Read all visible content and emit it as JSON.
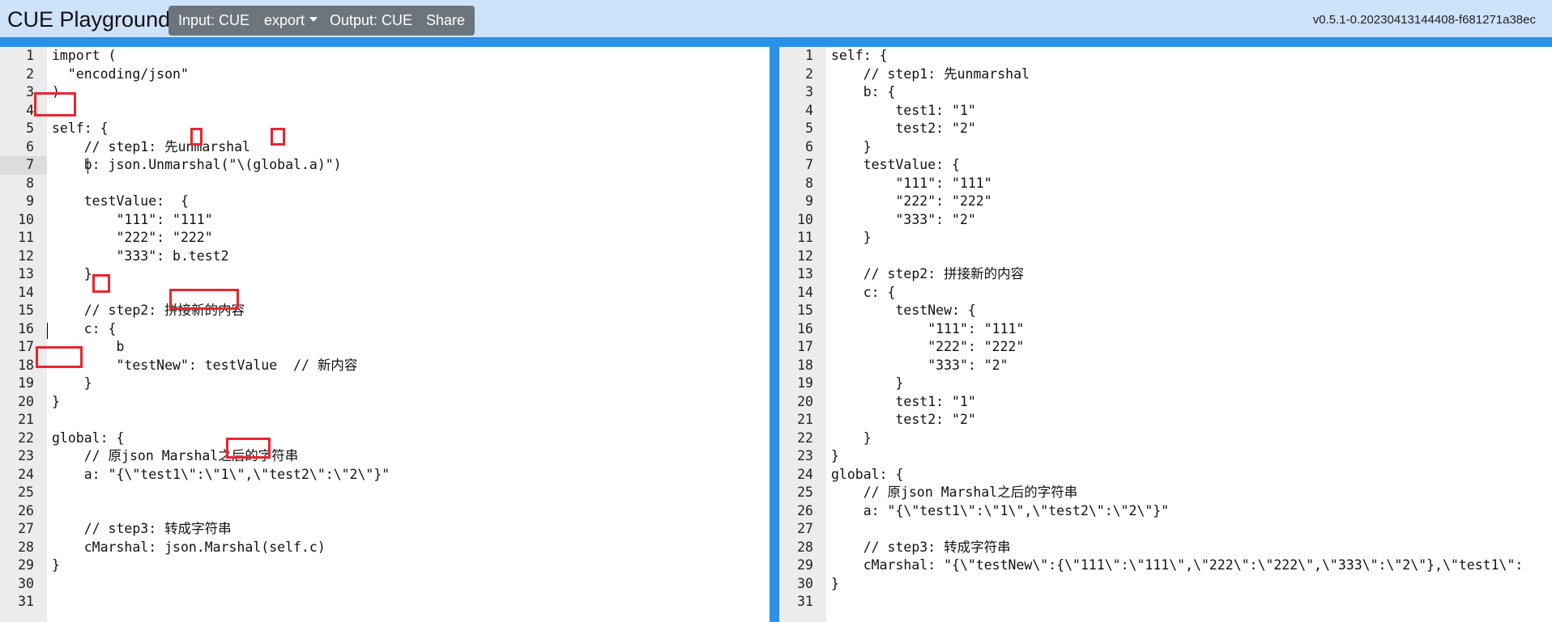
{
  "header": {
    "title": "CUE Playground",
    "buttons": {
      "input": "Input: CUE",
      "export": "export",
      "output": "Output: CUE",
      "share": "Share"
    },
    "version": "v0.5.1-0.20230413144408-f681271a38ec"
  },
  "colors": {
    "header_bg": "#cfe2fb",
    "accent_blue": "#2b90e8",
    "button_bg": "#6c757d",
    "highlight_red": "#e8262f"
  },
  "left_editor": {
    "lines": [
      {
        "n": "1",
        "t": "import ("
      },
      {
        "n": "2",
        "t": "  \"encoding/json\""
      },
      {
        "n": "3",
        "t": ")"
      },
      {
        "n": "4",
        "t": ""
      },
      {
        "n": "5",
        "t": "self: {"
      },
      {
        "n": "6",
        "t": "    // step1: 先unmarshal"
      },
      {
        "n": "7",
        "t": "    b: json.Unmarshal(\"\\(global.a)\")"
      },
      {
        "n": "8",
        "t": ""
      },
      {
        "n": "9",
        "t": "    testValue:  {"
      },
      {
        "n": "10",
        "t": "        \"111\": \"111\""
      },
      {
        "n": "11",
        "t": "        \"222\": \"222\""
      },
      {
        "n": "12",
        "t": "        \"333\": b.test2"
      },
      {
        "n": "13",
        "t": "    }"
      },
      {
        "n": "14",
        "t": ""
      },
      {
        "n": "15",
        "t": "    // step2: 拼接新的内容"
      },
      {
        "n": "16",
        "t": "    c: {"
      },
      {
        "n": "17",
        "t": "        b"
      },
      {
        "n": "18",
        "t": "        \"testNew\": testValue  // 新内容"
      },
      {
        "n": "19",
        "t": "    }"
      },
      {
        "n": "20",
        "t": "}"
      },
      {
        "n": "21",
        "t": ""
      },
      {
        "n": "22",
        "t": "global: {"
      },
      {
        "n": "23",
        "t": "    // 原json Marshal之后的字符串"
      },
      {
        "n": "24",
        "t": "    a: \"{\\\"test1\\\":\\\"1\\\",\\\"test2\\\":\\\"2\\\"}\""
      },
      {
        "n": "25",
        "t": ""
      },
      {
        "n": "26",
        "t": ""
      },
      {
        "n": "27",
        "t": "    // step3: 转成字符串"
      },
      {
        "n": "28",
        "t": "    cMarshal: json.Marshal(self.c)"
      },
      {
        "n": "29",
        "t": "}"
      },
      {
        "n": "30",
        "t": ""
      },
      {
        "n": "31",
        "t": ""
      }
    ]
  },
  "right_editor": {
    "lines": [
      {
        "n": "1",
        "t": "self: {"
      },
      {
        "n": "2",
        "t": "    // step1: 先unmarshal"
      },
      {
        "n": "3",
        "t": "    b: {"
      },
      {
        "n": "4",
        "t": "        test1: \"1\""
      },
      {
        "n": "5",
        "t": "        test2: \"2\""
      },
      {
        "n": "6",
        "t": "    }"
      },
      {
        "n": "7",
        "t": "    testValue: {"
      },
      {
        "n": "8",
        "t": "        \"111\": \"111\""
      },
      {
        "n": "9",
        "t": "        \"222\": \"222\""
      },
      {
        "n": "10",
        "t": "        \"333\": \"2\""
      },
      {
        "n": "11",
        "t": "    }"
      },
      {
        "n": "12",
        "t": ""
      },
      {
        "n": "13",
        "t": "    // step2: 拼接新的内容"
      },
      {
        "n": "14",
        "t": "    c: {"
      },
      {
        "n": "15",
        "t": "        testNew: {"
      },
      {
        "n": "16",
        "t": "            \"111\": \"111\""
      },
      {
        "n": "17",
        "t": "            \"222\": \"222\""
      },
      {
        "n": "18",
        "t": "            \"333\": \"2\""
      },
      {
        "n": "19",
        "t": "        }"
      },
      {
        "n": "20",
        "t": "        test1: \"1\""
      },
      {
        "n": "21",
        "t": "        test2: \"2\""
      },
      {
        "n": "22",
        "t": "    }"
      },
      {
        "n": "23",
        "t": "}"
      },
      {
        "n": "24",
        "t": "global: {"
      },
      {
        "n": "25",
        "t": "    // 原json Marshal之后的字符串"
      },
      {
        "n": "26",
        "t": "    a: \"{\\\"test1\\\":\\\"1\\\",\\\"test2\\\":\\\"2\\\"}\""
      },
      {
        "n": "27",
        "t": ""
      },
      {
        "n": "28",
        "t": "    // step3: 转成字符串"
      },
      {
        "n": "29",
        "t": "    cMarshal: \"{\\\"testNew\\\":{\\\"111\\\":\\\"111\\\",\\\"222\\\":\\\"222\\\",\\\"333\\\":\\\"2\\\"},\\\"test1\\\":"
      },
      {
        "n": "30",
        "t": "}"
      },
      {
        "n": "31",
        "t": ""
      }
    ]
  }
}
